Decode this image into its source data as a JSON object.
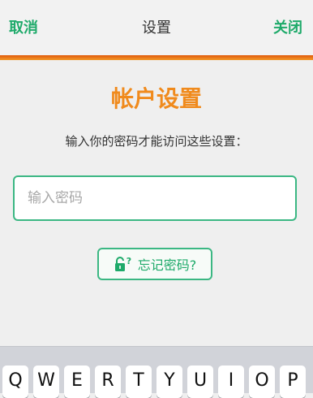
{
  "nav": {
    "cancel_label": "取消",
    "title": "设置",
    "close_label": "关闭"
  },
  "main": {
    "heading": "帐户设置",
    "prompt": "输入你的密码才能访问这些设置：",
    "password_placeholder": "输入密码",
    "forgot_label": "忘记密码?",
    "forgot_icon": "lock-question-icon"
  },
  "keyboard": {
    "keys": [
      "Q",
      "W",
      "E",
      "R",
      "T",
      "Y",
      "U",
      "I",
      "O",
      "P"
    ]
  },
  "colors": {
    "accent_green": "#1eaa6a",
    "heading_orange": "#f08a1c",
    "nav_bar_orange": "#e0590b"
  }
}
